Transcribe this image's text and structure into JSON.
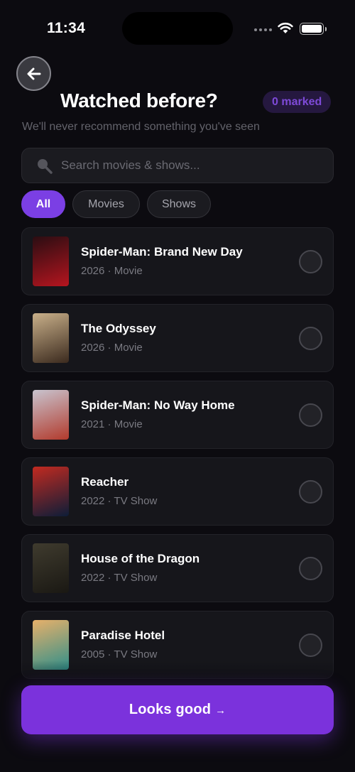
{
  "status": {
    "time": "11:34"
  },
  "header": {
    "title": "Watched before?",
    "marked_badge": "0 marked",
    "subtitle": "We'll never recommend something you've seen"
  },
  "search": {
    "placeholder": "Search movies & shows..."
  },
  "filters": [
    {
      "label": "All",
      "active": true
    },
    {
      "label": "Movies",
      "active": false
    },
    {
      "label": "Shows",
      "active": false
    }
  ],
  "titles": [
    {
      "title": "Spider-Man: Brand New Day",
      "meta": "2026 · Movie",
      "poster_colors": [
        "#2a0d12",
        "#b5151f"
      ]
    },
    {
      "title": "The Odyssey",
      "meta": "2026 · Movie",
      "poster_colors": [
        "#c9b08a",
        "#3b2a1e"
      ]
    },
    {
      "title": "Spider-Man: No Way Home",
      "meta": "2021 · Movie",
      "poster_colors": [
        "#c8c4cf",
        "#b23a2c"
      ]
    },
    {
      "title": "Reacher",
      "meta": "2022 · TV Show",
      "poster_colors": [
        "#c22a20",
        "#0d1d38"
      ]
    },
    {
      "title": "House of the Dragon",
      "meta": "2022 · TV Show",
      "poster_colors": [
        "#3f3b2e",
        "#1a1813"
      ]
    },
    {
      "title": "Paradise Hotel",
      "meta": "2005 · TV Show",
      "poster_colors": [
        "#e7b06a",
        "#2f8f8a"
      ]
    }
  ],
  "cta": {
    "label": "Looks good",
    "arrow": "→"
  },
  "colors": {
    "accent": "#7b32dc",
    "background": "#0c0b10",
    "card": "#16161b"
  }
}
